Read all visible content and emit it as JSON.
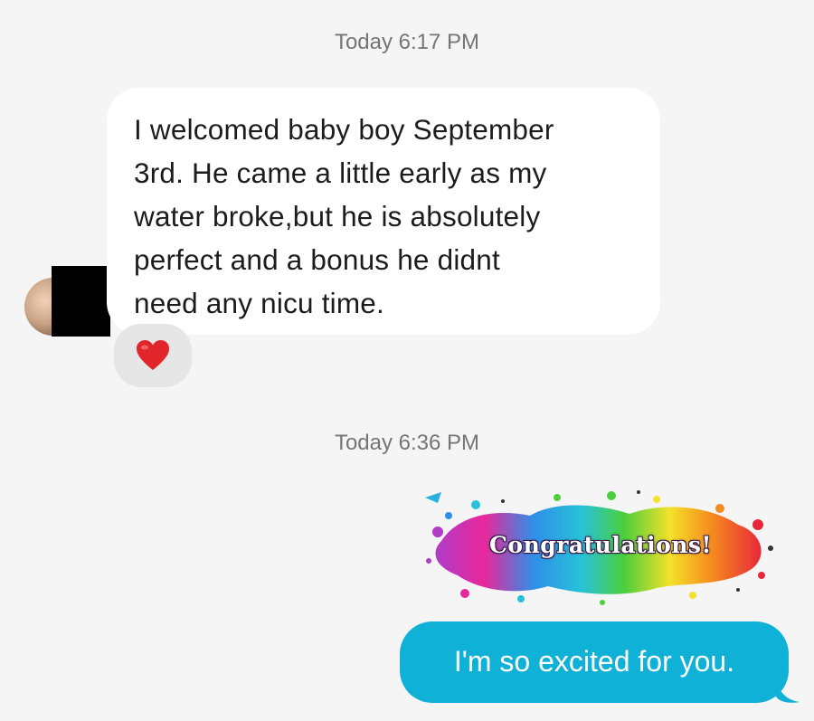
{
  "conversation": {
    "timestamp_1": "Today 6:17 PM",
    "incoming_message": {
      "lines": [
        "I welcomed baby boy September",
        "3rd. He came a little early as my",
        "water broke,but he is absolutely",
        "perfect and a bonus he didnt",
        "need any nicu time."
      ],
      "reaction": "red-heart-icon"
    },
    "timestamp_2": "Today 6:36 PM",
    "sticker": {
      "text": "Congratulations!"
    },
    "outgoing_message": "I'm so excited for you."
  },
  "colors": {
    "background": "#f5f5f5",
    "incoming_bubble": "#ffffff",
    "outgoing_bubble": "#0fb2d6",
    "reaction_pill": "#e6e6e6",
    "heart": "#e0252b"
  }
}
